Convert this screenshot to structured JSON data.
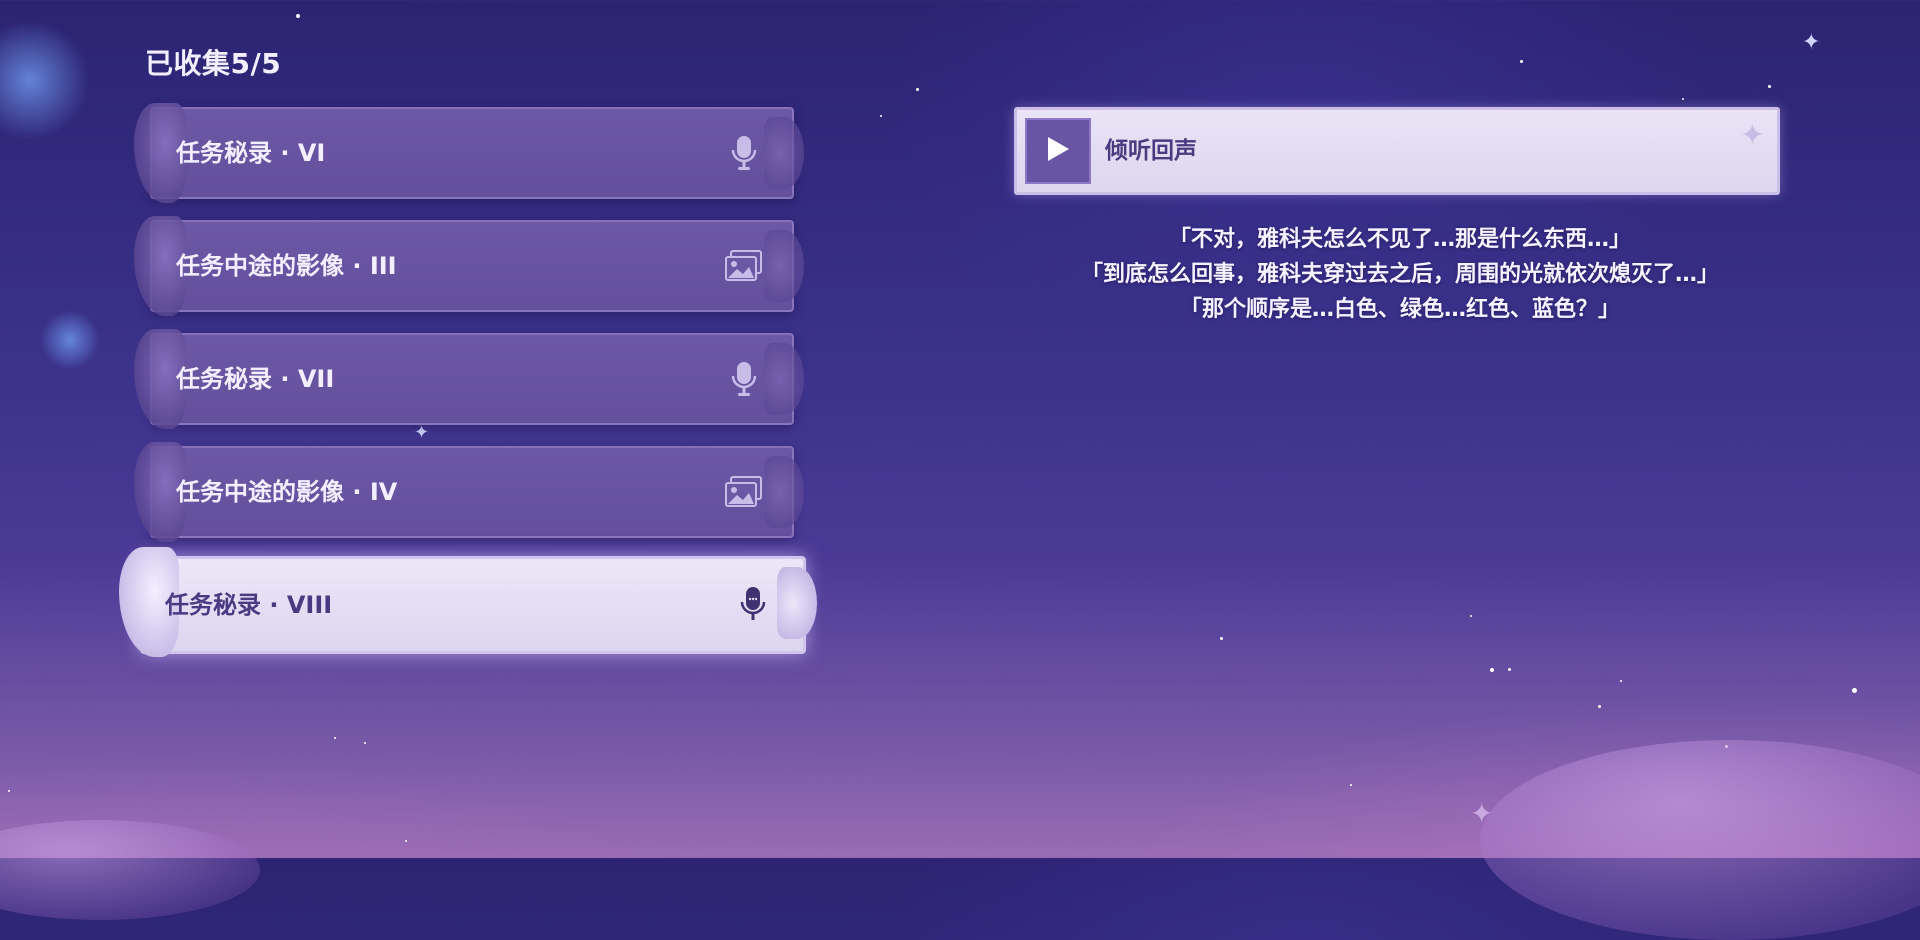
{
  "header": {
    "collected_label": "已收集5/5"
  },
  "items": [
    {
      "label": "任务秘录 · VI",
      "icon": "microphone-icon",
      "selected": false
    },
    {
      "label": "任务中途的影像 · III",
      "icon": "image-icon",
      "selected": false
    },
    {
      "label": "任务秘录 · VII",
      "icon": "microphone-icon",
      "selected": false
    },
    {
      "label": "任务中途的影像 · IV",
      "icon": "image-icon",
      "selected": false
    },
    {
      "label": "任务秘录 · VIII",
      "icon": "microphone-icon",
      "selected": true
    }
  ],
  "player": {
    "title": "倾听回声",
    "play_icon": "play-icon"
  },
  "subtitles": [
    "「不对，雅科夫怎么不见了…那是什么东西…」",
    "「到底怎么回事，雅科夫穿过去之后，周围的光就依次熄灭了…」",
    "「那个顺序是…白色、绿色…红色、蓝色？」"
  ],
  "colors": {
    "item_bg": "#6d58a6",
    "item_selected_bg": "#ece7f8",
    "selected_text": "#4b3a82",
    "play_button": "#6a55a4"
  }
}
